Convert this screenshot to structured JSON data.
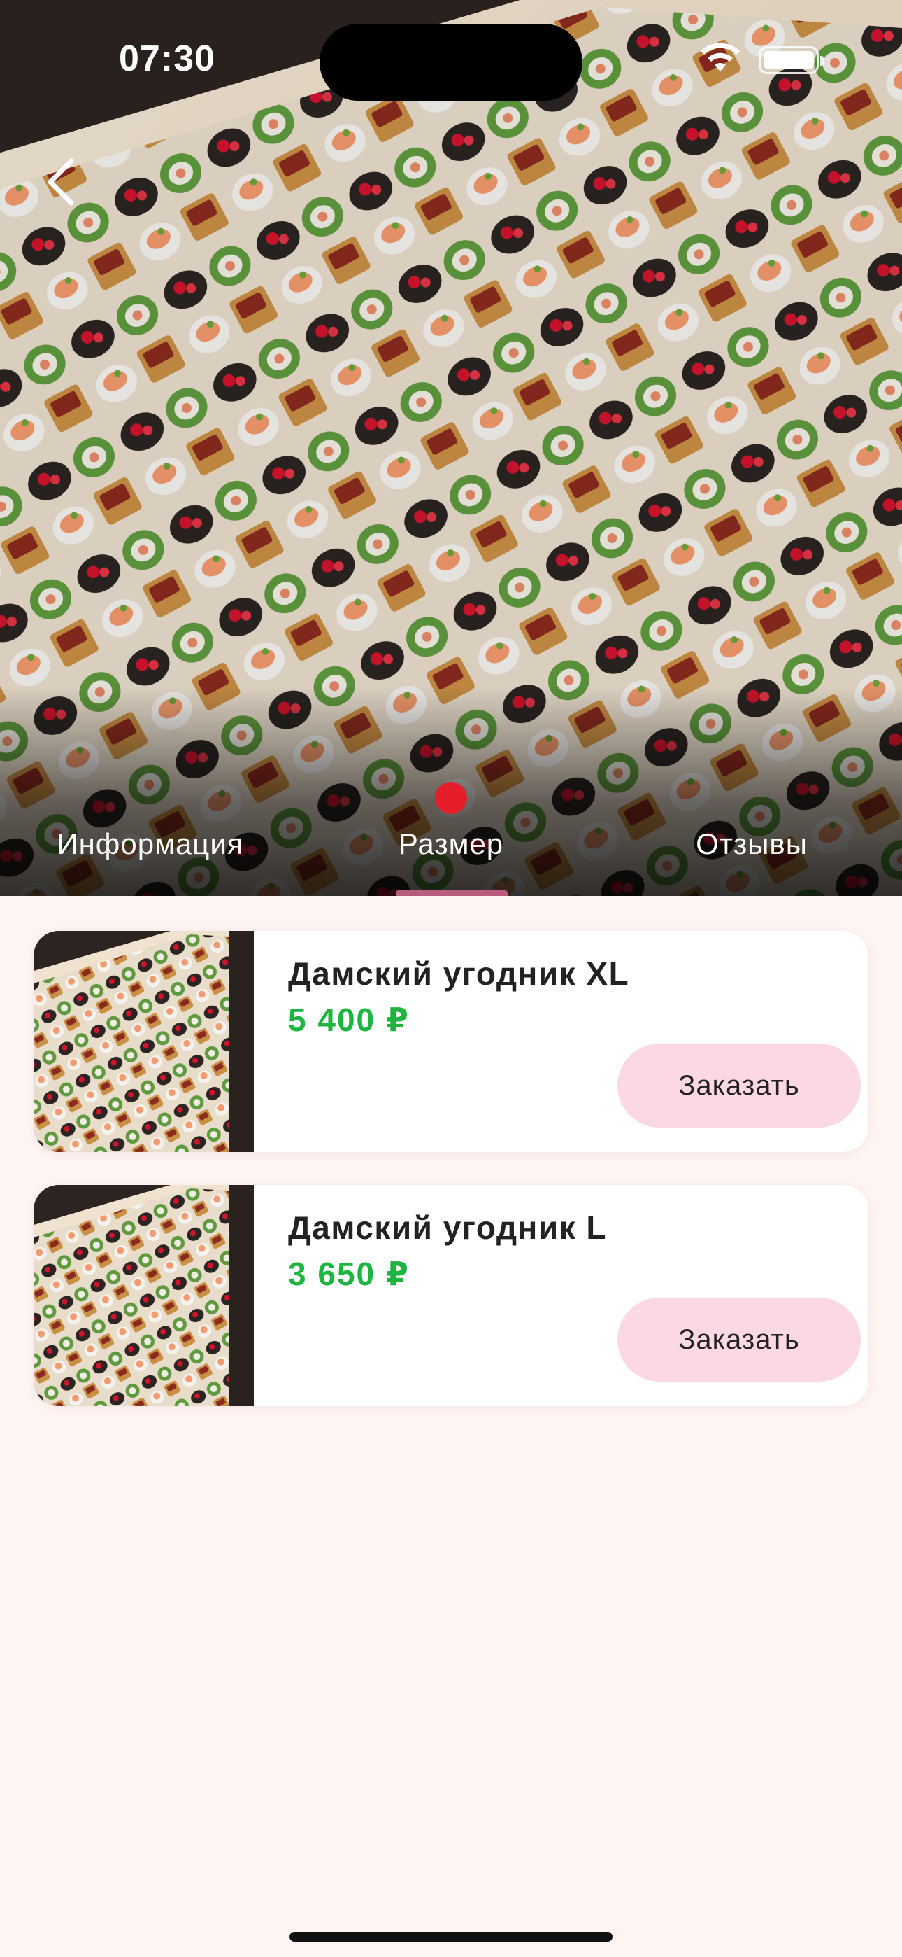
{
  "status_bar": {
    "time": "07:30"
  },
  "hero": {
    "image": "catering-canape-platter-photo"
  },
  "tabs": [
    {
      "label": "Информация",
      "active": false
    },
    {
      "label": "Размер",
      "active": true
    },
    {
      "label": "Отзывы",
      "active": false
    }
  ],
  "products": [
    {
      "title": "Дамский угодник XL",
      "price": "5 400 ₽",
      "button": "Заказать"
    },
    {
      "title": "Дамский угодник L",
      "price": "3 650 ₽",
      "button": "Заказать"
    }
  ],
  "colors": {
    "background": "#FEF4F2",
    "price": "#1DB53F",
    "order_button": "#FCD9E2",
    "tab_dot": "#E61E2A",
    "tab_indicator": "#B85C7C"
  }
}
